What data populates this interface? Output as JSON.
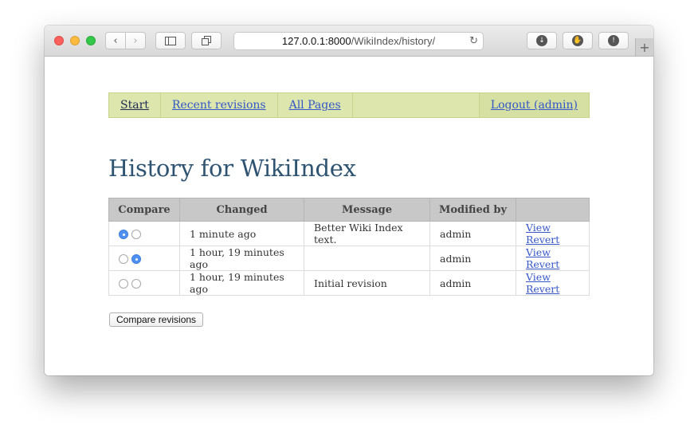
{
  "browser": {
    "url_host": "127.0.0.1:8000",
    "url_path": "/WikiIndex/history/",
    "back_icon": "‹",
    "forward_icon": "›",
    "reload_icon": "↻",
    "newtab_icon": "+"
  },
  "menu": {
    "items": [
      {
        "label": "Start"
      },
      {
        "label": "Recent revisions"
      },
      {
        "label": "All Pages"
      }
    ],
    "logout": "Logout (admin)"
  },
  "page": {
    "title": "History for WikiIndex"
  },
  "table": {
    "headers": [
      "Compare",
      "Changed",
      "Message",
      "Modified by",
      ""
    ],
    "rows": [
      {
        "changed": "1 minute ago",
        "message": "Better Wiki Index text.",
        "modified_by": "admin",
        "view": "View",
        "revert": "Revert",
        "radio_a": true,
        "radio_b": false
      },
      {
        "changed": "1 hour, 19 minutes ago",
        "message": "",
        "modified_by": "admin",
        "view": "View",
        "revert": "Revert",
        "radio_a": false,
        "radio_b": true
      },
      {
        "changed": "1 hour, 19 minutes ago",
        "message": "Initial revision",
        "modified_by": "admin",
        "view": "View",
        "revert": "Revert",
        "radio_a": false,
        "radio_b": false
      }
    ]
  },
  "compare_button": "Compare revisions",
  "colors": {
    "menu_bg": "#dce6ad",
    "title": "#2f5472",
    "link": "#3456c8",
    "radio_selected": "#4d90f0"
  }
}
